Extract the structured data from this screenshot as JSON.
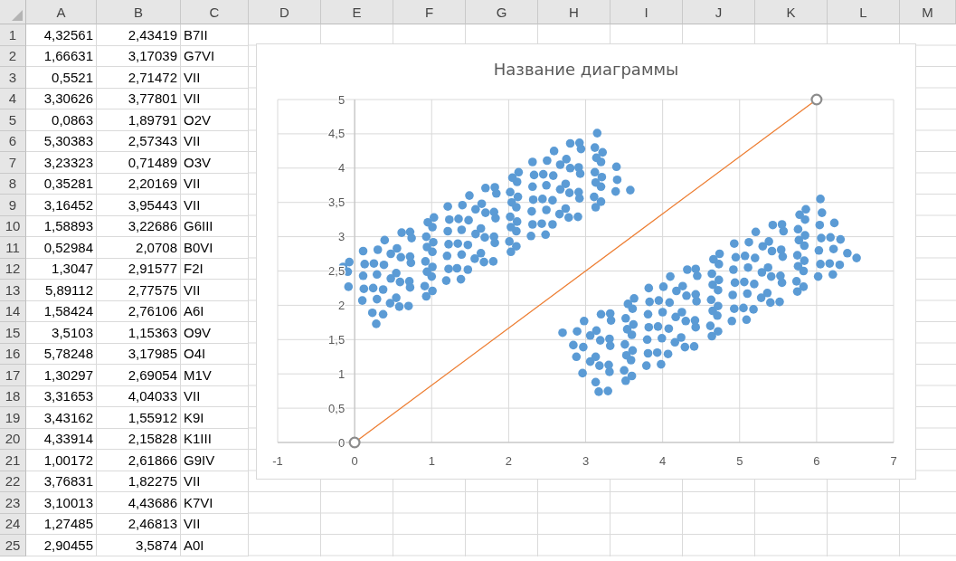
{
  "sheet": {
    "columns": [
      "A",
      "B",
      "C",
      "D",
      "E",
      "F",
      "G",
      "H",
      "I",
      "J",
      "K",
      "L",
      "M"
    ],
    "rows": [
      {
        "number": "1",
        "cells": [
          {
            "kind": "number",
            "text": "4,32561"
          },
          {
            "kind": "number",
            "text": "2,43419"
          },
          {
            "kind": "text",
            "text": "B7II"
          }
        ]
      },
      {
        "number": "2",
        "cells": [
          {
            "kind": "number",
            "text": "1,66631"
          },
          {
            "kind": "number",
            "text": "3,17039"
          },
          {
            "kind": "text",
            "text": "G7VI"
          }
        ]
      },
      {
        "number": "3",
        "cells": [
          {
            "kind": "number",
            "text": "0,5521"
          },
          {
            "kind": "number",
            "text": "2,71472"
          },
          {
            "kind": "text",
            "text": "VII"
          }
        ]
      },
      {
        "number": "4",
        "cells": [
          {
            "kind": "number",
            "text": "3,30626"
          },
          {
            "kind": "number",
            "text": "3,77801"
          },
          {
            "kind": "text",
            "text": "VII"
          }
        ]
      },
      {
        "number": "5",
        "cells": [
          {
            "kind": "number",
            "text": "0,0863"
          },
          {
            "kind": "number",
            "text": "1,89791"
          },
          {
            "kind": "text",
            "text": "O2V"
          }
        ]
      },
      {
        "number": "6",
        "cells": [
          {
            "kind": "number",
            "text": "5,30383"
          },
          {
            "kind": "number",
            "text": "2,57343"
          },
          {
            "kind": "text",
            "text": "VII"
          }
        ]
      },
      {
        "number": "7",
        "cells": [
          {
            "kind": "number",
            "text": "3,23323"
          },
          {
            "kind": "number",
            "text": "0,71489"
          },
          {
            "kind": "text",
            "text": "O3V"
          }
        ]
      },
      {
        "number": "8",
        "cells": [
          {
            "kind": "number",
            "text": "0,35281"
          },
          {
            "kind": "number",
            "text": "2,20169"
          },
          {
            "kind": "text",
            "text": "VII"
          }
        ]
      },
      {
        "number": "9",
        "cells": [
          {
            "kind": "number",
            "text": "3,16452"
          },
          {
            "kind": "number",
            "text": "3,95443"
          },
          {
            "kind": "text",
            "text": "VII"
          }
        ]
      },
      {
        "number": "10",
        "cells": [
          {
            "kind": "number",
            "text": "1,58893"
          },
          {
            "kind": "number",
            "text": "3,22686"
          },
          {
            "kind": "text",
            "text": "G6III"
          }
        ]
      },
      {
        "number": "11",
        "cells": [
          {
            "kind": "number",
            "text": "0,52984"
          },
          {
            "kind": "number",
            "text": "2,0708"
          },
          {
            "kind": "text",
            "text": "B0VI"
          }
        ]
      },
      {
        "number": "12",
        "cells": [
          {
            "kind": "number",
            "text": "1,3047"
          },
          {
            "kind": "number",
            "text": "2,91577"
          },
          {
            "kind": "text",
            "text": "F2I"
          }
        ]
      },
      {
        "number": "13",
        "cells": [
          {
            "kind": "number",
            "text": "5,89112"
          },
          {
            "kind": "number",
            "text": "2,77575"
          },
          {
            "kind": "text",
            "text": "VII"
          }
        ]
      },
      {
        "number": "14",
        "cells": [
          {
            "kind": "number",
            "text": "1,58424"
          },
          {
            "kind": "number",
            "text": "2,76106"
          },
          {
            "kind": "text",
            "text": "A6I"
          }
        ]
      },
      {
        "number": "15",
        "cells": [
          {
            "kind": "number",
            "text": "3,5103"
          },
          {
            "kind": "number",
            "text": "1,15363"
          },
          {
            "kind": "text",
            "text": "O9V"
          }
        ]
      },
      {
        "number": "16",
        "cells": [
          {
            "kind": "number",
            "text": "5,78248"
          },
          {
            "kind": "number",
            "text": "3,17985"
          },
          {
            "kind": "text",
            "text": "O4I"
          }
        ]
      },
      {
        "number": "17",
        "cells": [
          {
            "kind": "number",
            "text": "1,30297"
          },
          {
            "kind": "number",
            "text": "2,69054"
          },
          {
            "kind": "text",
            "text": "M1V"
          }
        ]
      },
      {
        "number": "18",
        "cells": [
          {
            "kind": "number",
            "text": "3,31653"
          },
          {
            "kind": "number",
            "text": "4,04033"
          },
          {
            "kind": "text",
            "text": "VII"
          }
        ]
      },
      {
        "number": "19",
        "cells": [
          {
            "kind": "number",
            "text": "3,43162"
          },
          {
            "kind": "number",
            "text": "1,55912"
          },
          {
            "kind": "text",
            "text": "K9I"
          }
        ]
      },
      {
        "number": "20",
        "cells": [
          {
            "kind": "number",
            "text": "4,33914"
          },
          {
            "kind": "number",
            "text": "2,15828"
          },
          {
            "kind": "text",
            "text": "K1III"
          }
        ]
      },
      {
        "number": "21",
        "cells": [
          {
            "kind": "number",
            "text": "1,00172"
          },
          {
            "kind": "number",
            "text": "2,61866"
          },
          {
            "kind": "text",
            "text": "G9IV"
          }
        ]
      },
      {
        "number": "22",
        "cells": [
          {
            "kind": "number",
            "text": "3,76831"
          },
          {
            "kind": "number",
            "text": "1,82275"
          },
          {
            "kind": "text",
            "text": "VII"
          }
        ]
      },
      {
        "number": "23",
        "cells": [
          {
            "kind": "number",
            "text": "3,10013"
          },
          {
            "kind": "number",
            "text": "4,43686"
          },
          {
            "kind": "text",
            "text": "K7VI"
          }
        ]
      },
      {
        "number": "24",
        "cells": [
          {
            "kind": "number",
            "text": "1,27485"
          },
          {
            "kind": "number",
            "text": "2,46813"
          },
          {
            "kind": "text",
            "text": "VII"
          }
        ]
      },
      {
        "number": "25",
        "cells": [
          {
            "kind": "number",
            "text": "2,90455"
          },
          {
            "kind": "number",
            "text": "3,5874"
          },
          {
            "kind": "text",
            "text": "A0I"
          }
        ]
      }
    ]
  },
  "chart": {
    "chart_data": {
      "type": "scatter",
      "title": "Название диаграммы",
      "grid": true,
      "xlim": [
        -1,
        7
      ],
      "ylim": [
        0,
        5
      ],
      "xticks": [
        -1,
        0,
        1,
        2,
        3,
        4,
        5,
        6,
        7
      ],
      "yticks": [
        0,
        {
          "value": 0.5,
          "label": "0,5"
        },
        1,
        {
          "value": 1.5,
          "label": "1,5"
        },
        2,
        {
          "value": 2.5,
          "label": "2,5"
        },
        3,
        {
          "value": 3.5,
          "label": "3,5"
        },
        4,
        {
          "value": 4.5,
          "label": "4,5"
        },
        5
      ],
      "series": [
        {
          "type": "scatter",
          "color": "#5b9bd5",
          "x": [
            0.28,
            0.37,
            0.58,
            0.7,
            0.93,
            1.01,
            1.19,
            1.38,
            1.47,
            1.68,
            1.8,
            2.03,
            2.1,
            2.29,
            2.48,
            2.57,
            2.78,
            2.9,
            3.13,
            3.2,
            3.39,
            3.58,
            0.23,
            0.46,
            0.54,
            0.72,
            0.91,
            1.0,
            1.22,
            1.33,
            1.56,
            1.64,
            1.82,
            2.01,
            2.1,
            2.31,
            2.43,
            2.66,
            2.74,
            2.92,
            3.11,
            3.2,
            3.41,
            0.1,
            0.29,
            0.37,
            0.59,
            0.71,
            0.94,
            1.01,
            1.2,
            1.39,
            1.47,
            1.69,
            1.81,
            2.03,
            2.11,
            2.3,
            2.49,
            2.57,
            2.79,
            2.91,
            3.13,
            3.21,
            3.4,
            0.12,
            0.24,
            0.47,
            0.54,
            0.73,
            0.92,
            1.01,
            1.22,
            1.34,
            1.57,
            1.64,
            1.83,
            2.02,
            2.1,
            2.32,
            2.44,
            2.67,
            2.74,
            2.93,
            3.12,
            3.2,
            -0.08,
            0.11,
            0.29,
            0.38,
            0.6,
            0.72,
            0.94,
            1.02,
            1.21,
            1.39,
            1.48,
            1.7,
            1.81,
            2.04,
            2.12,
            2.31,
            2.49,
            2.58,
            2.8,
            2.91,
            3.14,
            3.22,
            -0.09,
            0.13,
            0.25,
            0.47,
            0.55,
            0.74,
            0.93,
            1.01,
            1.23,
            1.35,
            1.57,
            1.65,
            1.84,
            2.02,
            2.11,
            2.33,
            2.45,
            2.67,
            2.75,
            2.94,
            3.12,
            -0.15,
            -0.07,
            0.11,
            0.3,
            0.39,
            0.61,
            0.72,
            0.95,
            1.03,
            1.21,
            1.4,
            1.49,
            1.7,
            1.82,
            2.05,
            2.13,
            2.31,
            2.5,
            2.59,
            2.8,
            2.92,
            3.15,
            3.17,
            3.29,
            3.52,
            3.6,
            3.79,
            3.98,
            4.07,
            4.29,
            4.41,
            4.64,
            4.72,
            4.9,
            5.09,
            5.18,
            5.4,
            5.52,
            5.75,
            5.83,
            6.02,
            6.21,
            6.3,
            6.52,
            3.13,
            3.31,
            3.5,
            3.59,
            3.81,
            3.93,
            4.16,
            4.24,
            4.43,
            4.62,
            4.71,
            4.93,
            5.05,
            5.28,
            5.36,
            5.55,
            5.74,
            5.83,
            6.05,
            6.17,
            6.4,
            2.96,
            3.18,
            3.3,
            3.53,
            3.61,
            3.8,
            3.99,
            4.08,
            4.3,
            4.42,
            4.65,
            4.72,
            4.91,
            5.1,
            5.19,
            5.41,
            5.53,
            5.76,
            5.84,
            6.03,
            6.22,
            6.31,
            3.06,
            3.13,
            3.32,
            3.51,
            3.6,
            3.82,
            3.94,
            4.17,
            4.25,
            4.44,
            4.63,
            4.72,
            4.94,
            5.06,
            5.29,
            5.37,
            5.56,
            5.75,
            5.84,
            6.06,
            6.18,
            2.88,
            2.97,
            3.19,
            3.31,
            3.54,
            3.62,
            3.81,
            4.0,
            4.09,
            4.31,
            4.43,
            4.65,
            4.73,
            4.92,
            5.11,
            5.2,
            5.42,
            5.54,
            5.77,
            5.85,
            6.04,
            6.23,
            2.84,
            3.06,
            3.14,
            3.33,
            3.52,
            3.61,
            3.83,
            3.95,
            4.18,
            4.26,
            4.45,
            4.64,
            4.73,
            4.95,
            5.07,
            5.3,
            5.38,
            5.57,
            5.76,
            5.85,
            6.07,
            2.7,
            2.89,
            2.98,
            3.2,
            3.32,
            3.55,
            3.63,
            3.82,
            4.01,
            4.1,
            4.32,
            4.43,
            4.66,
            4.74,
            4.93,
            5.12,
            5.21,
            5.43,
            5.55,
            5.78,
            5.86,
            6.05
          ],
          "values": [
            1.73,
            1.87,
            1.98,
            1.99,
            2.13,
            2.21,
            2.36,
            2.38,
            2.52,
            2.63,
            2.64,
            2.78,
            2.86,
            3.01,
            3.03,
            3.18,
            3.28,
            3.29,
            3.43,
            3.51,
            3.66,
            3.68,
            1.89,
            2.03,
            2.11,
            2.26,
            2.28,
            2.42,
            2.53,
            2.54,
            2.68,
            2.76,
            2.91,
            2.93,
            3.08,
            3.18,
            3.19,
            3.33,
            3.41,
            3.56,
            3.58,
            3.73,
            3.83,
            2.07,
            2.09,
            2.23,
            2.34,
            2.35,
            2.49,
            2.56,
            2.72,
            2.74,
            2.88,
            2.99,
            3.0,
            3.14,
            3.22,
            3.37,
            3.39,
            3.53,
            3.64,
            3.65,
            3.79,
            3.87,
            4.02,
            2.24,
            2.25,
            2.39,
            2.47,
            2.62,
            2.64,
            2.78,
            2.89,
            2.9,
            3.04,
            3.12,
            3.27,
            3.29,
            3.43,
            3.54,
            3.55,
            3.69,
            3.77,
            3.92,
            3.94,
            4.09,
            2.27,
            2.43,
            2.45,
            2.59,
            2.7,
            2.71,
            2.85,
            2.92,
            3.08,
            3.1,
            3.24,
            3.35,
            3.36,
            3.5,
            3.58,
            3.73,
            3.75,
            3.89,
            4.0,
            4.01,
            4.15,
            4.23,
            2.49,
            2.6,
            2.61,
            2.75,
            2.83,
            2.98,
            3.0,
            3.14,
            3.25,
            3.26,
            3.4,
            3.48,
            3.63,
            3.65,
            3.8,
            3.9,
            3.91,
            4.05,
            4.13,
            4.28,
            4.3,
            2.56,
            2.63,
            2.79,
            2.81,
            2.95,
            3.06,
            3.07,
            3.21,
            3.28,
            3.44,
            3.46,
            3.6,
            3.71,
            3.72,
            3.86,
            3.94,
            4.09,
            4.11,
            4.25,
            4.36,
            4.37,
            4.51,
            0.74,
            0.75,
            0.9,
            0.97,
            1.12,
            1.14,
            1.29,
            1.39,
            1.4,
            1.55,
            1.62,
            1.77,
            1.79,
            1.94,
            2.04,
            2.05,
            2.2,
            2.27,
            2.42,
            2.45,
            2.59,
            2.69,
            0.88,
            1.03,
            1.05,
            1.2,
            1.3,
            1.31,
            1.46,
            1.53,
            1.68,
            1.7,
            1.85,
            1.95,
            1.96,
            2.11,
            2.18,
            2.33,
            2.35,
            2.5,
            2.6,
            2.61,
            2.76,
            1.01,
            1.12,
            1.13,
            1.27,
            1.34,
            1.5,
            1.52,
            1.66,
            1.77,
            1.78,
            1.92,
            1.99,
            2.15,
            2.17,
            2.31,
            2.42,
            2.43,
            2.57,
            2.65,
            2.8,
            2.82,
            2.96,
            1.18,
            1.25,
            1.41,
            1.43,
            1.57,
            1.68,
            1.69,
            1.83,
            1.9,
            2.06,
            2.08,
            2.22,
            2.33,
            2.34,
            2.48,
            2.55,
            2.71,
            2.73,
            2.87,
            2.98,
            2.99,
            1.25,
            1.39,
            1.49,
            1.51,
            1.65,
            1.72,
            1.87,
            1.9,
            2.04,
            2.14,
            2.16,
            2.3,
            2.37,
            2.52,
            2.55,
            2.69,
            2.79,
            2.81,
            2.95,
            3.02,
            3.17,
            3.2,
            1.42,
            1.56,
            1.63,
            1.78,
            1.81,
            1.95,
            2.05,
            2.07,
            2.21,
            2.28,
            2.43,
            2.46,
            2.6,
            2.7,
            2.72,
            2.86,
            2.93,
            3.08,
            3.11,
            3.25,
            3.35,
            1.6,
            1.62,
            1.77,
            1.87,
            1.88,
            2.02,
            2.1,
            2.25,
            2.27,
            2.42,
            2.52,
            2.53,
            2.67,
            2.75,
            2.9,
            2.92,
            3.07,
            3.17,
            3.18,
            3.32,
            3.4,
            3.55
          ]
        },
        {
          "type": "line",
          "color": "#ed7d31",
          "marker": "circle",
          "x": [
            0,
            6
          ],
          "values": [
            0,
            5
          ]
        }
      ]
    }
  }
}
